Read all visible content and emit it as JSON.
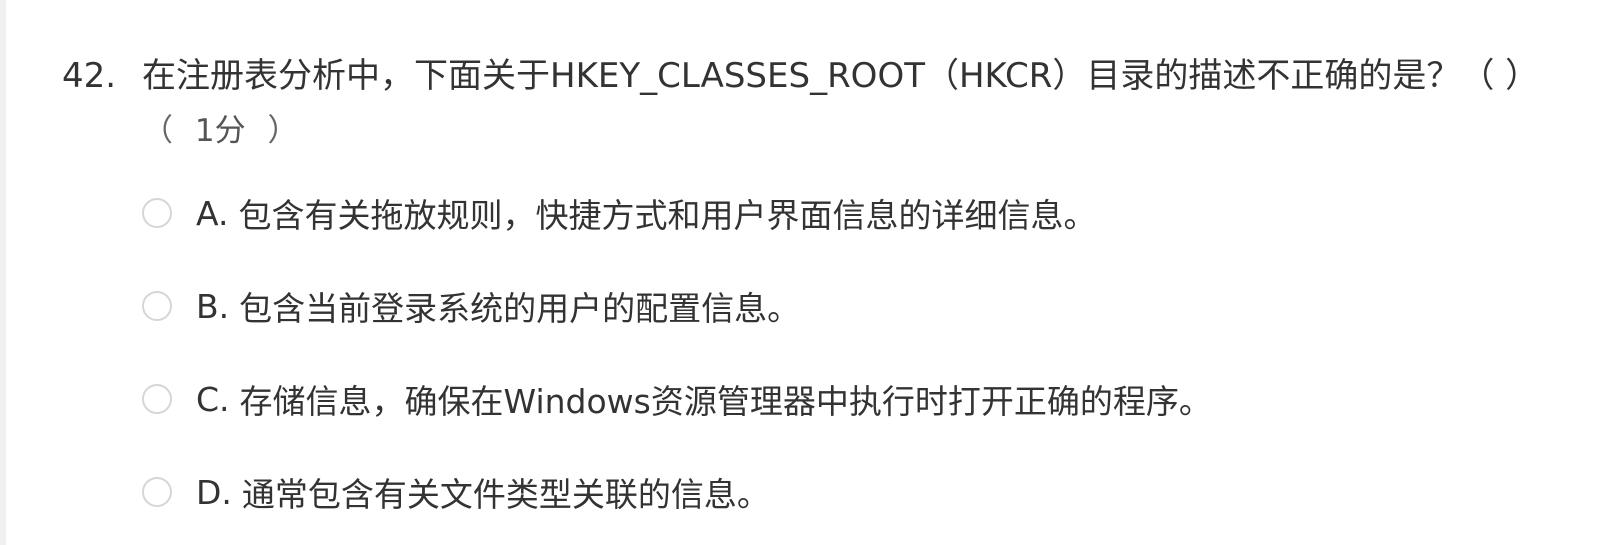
{
  "question": {
    "number": "42.",
    "text": "在注册表分析中，下面关于HKEY_CLASSES_ROOT（HKCR）目录的描述不正确的是？（ ）",
    "score": "1分",
    "score_open": "（",
    "score_close": "）"
  },
  "options": [
    {
      "letter": "A.",
      "text": "包含有关拖放规则，快捷方式和用户界面信息的详细信息。",
      "selected": false
    },
    {
      "letter": "B.",
      "text": "包含当前登录系统的用户的配置信息。",
      "selected": false
    },
    {
      "letter": "C.",
      "text": "存储信息，确保在Windows资源管理器中执行时打开正确的程序。",
      "selected": false
    },
    {
      "letter": "D.",
      "text": "通常包含有关文件类型关联的信息。",
      "selected": false
    }
  ]
}
